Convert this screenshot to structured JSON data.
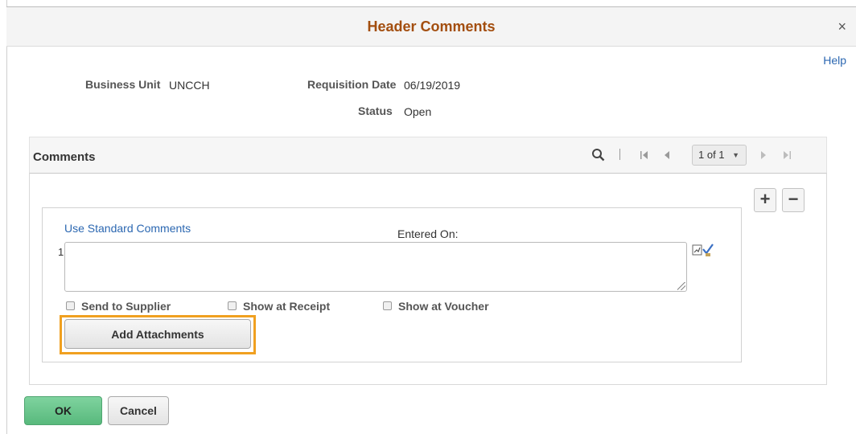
{
  "dialog": {
    "title": "Header Comments",
    "close_glyph": "×",
    "help_label": "Help"
  },
  "header_fields": {
    "business_unit_label": "Business Unit",
    "business_unit_value": "UNCCH",
    "requisition_date_label": "Requisition Date",
    "requisition_date_value": "06/19/2019",
    "status_label": "Status",
    "status_value": "Open"
  },
  "comments": {
    "section_title": "Comments",
    "pager": {
      "current": "1 of 1",
      "icons": [
        "search-icon",
        "first-page-icon",
        "previous-page-icon",
        "next-page-icon",
        "last-page-icon"
      ]
    },
    "add_row_glyph": "+",
    "delete_row_glyph": "−",
    "row": {
      "number": "1",
      "std_comments_link": "Use Standard Comments",
      "entered_on_label": "Entered On:",
      "comment_value": "",
      "checkboxes": [
        {
          "label": "Send to Supplier",
          "checked": false
        },
        {
          "label": "Show at Receipt",
          "checked": false
        },
        {
          "label": "Show at Voucher",
          "checked": false
        }
      ],
      "attach_button_label": "Add Attachments",
      "highlight_color": "#f0a020"
    }
  },
  "footer": {
    "ok_label": "OK",
    "cancel_label": "Cancel"
  },
  "colors": {
    "title": "#a34e0f",
    "link": "#2b67b1",
    "ok_button": "#6cc58e"
  }
}
